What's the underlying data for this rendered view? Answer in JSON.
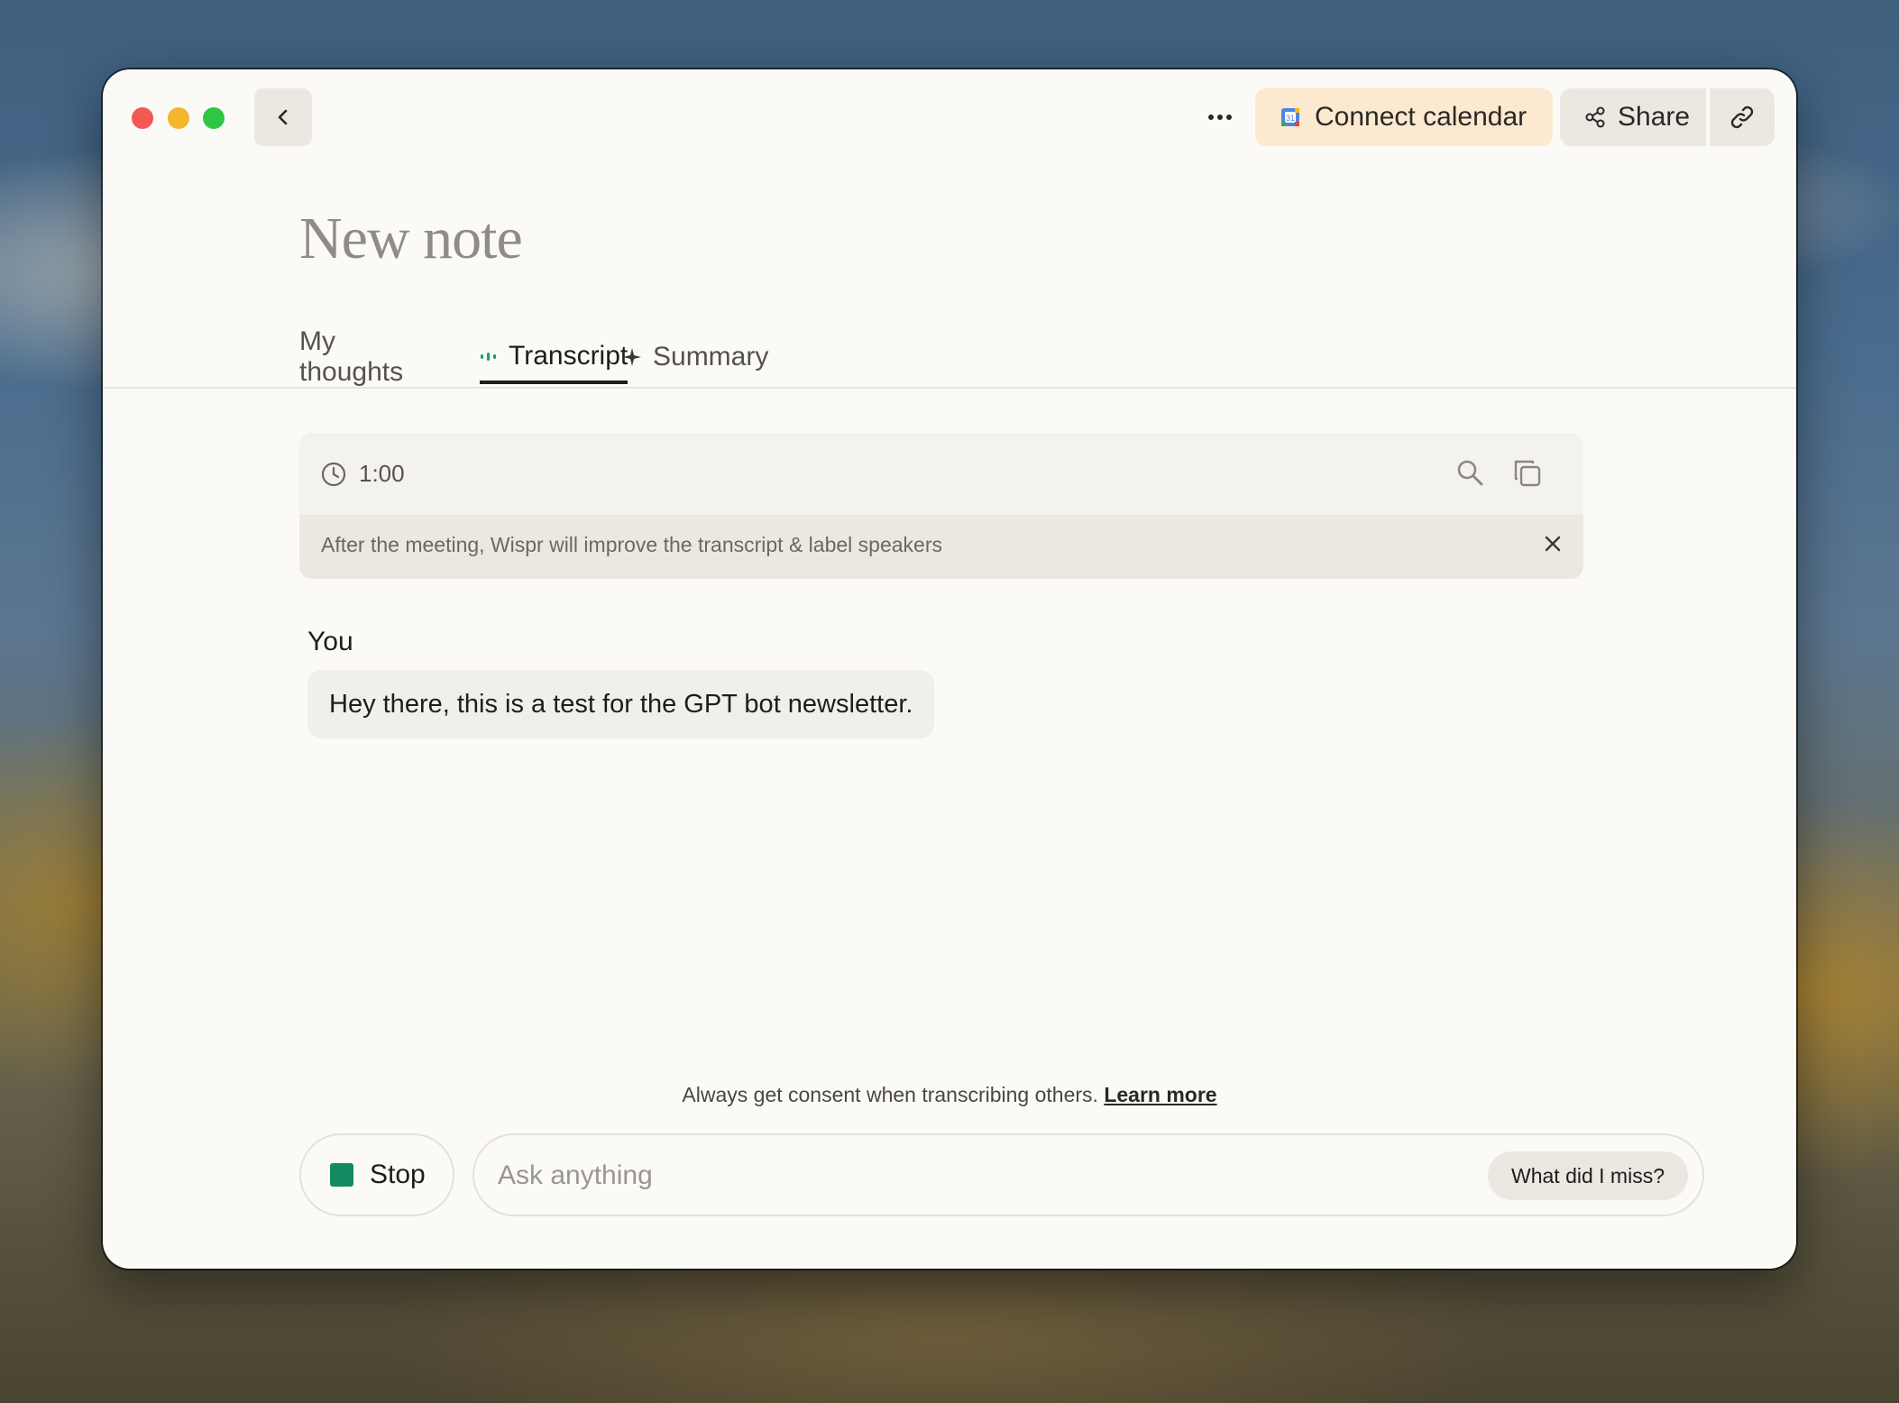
{
  "window": {
    "controls": [
      "close",
      "minimize",
      "zoom"
    ]
  },
  "toolbar": {
    "more_icon": "ellipsis-icon",
    "connect_calendar_label": "Connect calendar",
    "share_label": "Share",
    "link_icon": "link-icon"
  },
  "note": {
    "title": "New note"
  },
  "tabs": [
    {
      "label": "My thoughts",
      "active": false
    },
    {
      "label": "Transcript",
      "active": true,
      "icon": "recording-dots-icon"
    },
    {
      "label": "Summary",
      "active": false,
      "icon": "sparkle-icon"
    }
  ],
  "transcript": {
    "duration": "1:00",
    "notice": "After the meeting, Wispr will improve the transcript & label speakers",
    "entries": [
      {
        "speaker": "You",
        "text": "Hey there, this is a test for the GPT bot newsletter."
      }
    ]
  },
  "footer": {
    "consent_text": "Always get consent when transcribing others.",
    "learn_more": "Learn more",
    "stop_label": "Stop",
    "ask_placeholder": "Ask anything",
    "quick_prompt": "What did I miss?"
  },
  "colors": {
    "accent_green": "#138a62",
    "calendar_bg": "#fde9cf",
    "window_bg": "#fbfaf7"
  }
}
